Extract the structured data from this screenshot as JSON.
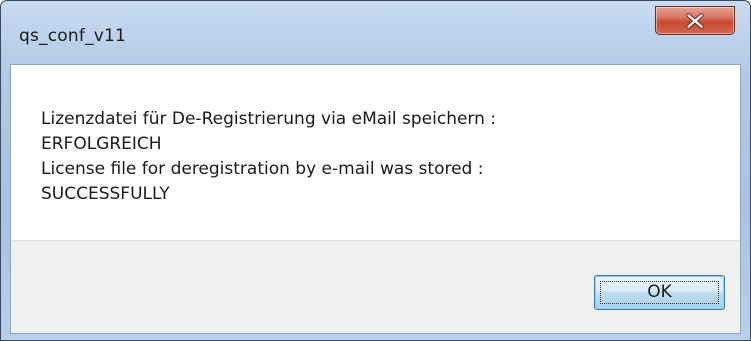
{
  "window": {
    "title": "qs_conf_v11",
    "close_icon": "close-icon"
  },
  "message": {
    "lines": [
      "Lizenzdatei für De-Registrierung via eMail speichern :",
      "ERFOLGREICH",
      "License file for deregistration by e-mail was stored :",
      "SUCCESSFULLY"
    ]
  },
  "buttons": {
    "ok_label": "OK"
  },
  "colors": {
    "close_button": "#c84a33",
    "ok_button_border": "#3c7fb1",
    "frame": "#b4cbe7"
  }
}
